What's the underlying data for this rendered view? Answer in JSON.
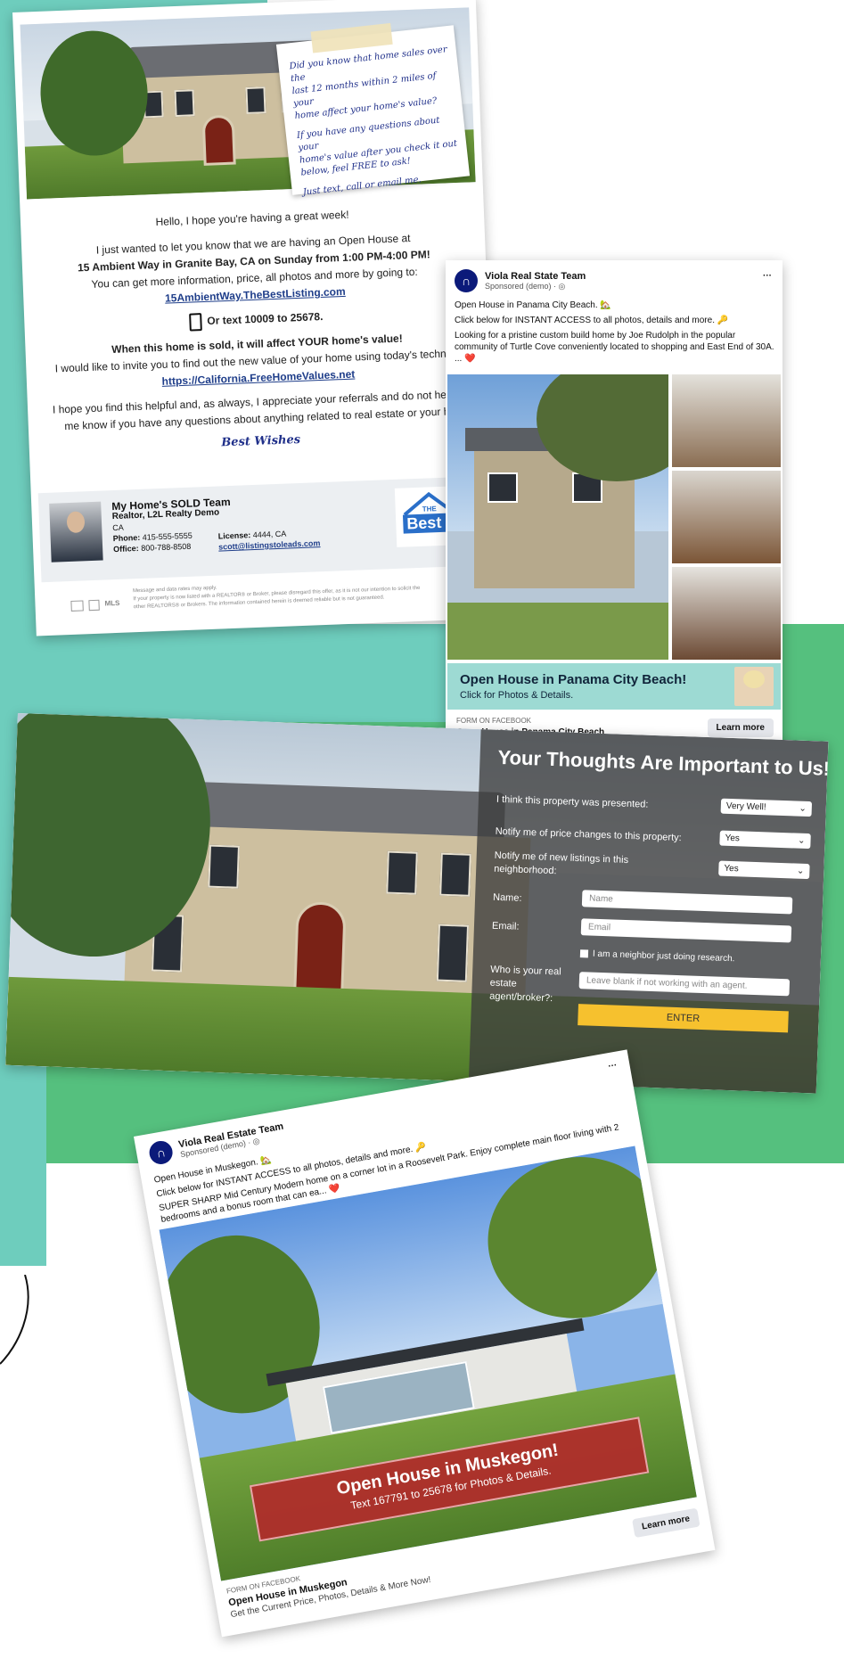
{
  "colors": {
    "teal": "#6ecdbd",
    "green": "#55c07e",
    "fb_blue": "#0b1a7a",
    "enter": "#f6c12e",
    "banner_teal": "#9ddad3",
    "banner_red": "#b5262a",
    "link": "#1f3e8a"
  },
  "letter": {
    "note": {
      "line1": "Did you know that home sales over the",
      "line2": "last 12 months within 2 miles of your",
      "line3": "home affect your home's value?",
      "line4": "If you have any questions about your",
      "line5": "home's value after you check it out",
      "line6": "below, feel FREE to ask!",
      "line7": "Just text, call or email me."
    },
    "greeting": "Hello, I hope you're having a great week!",
    "p1a": "I just wanted to let you know that we are having an Open House at",
    "p1b": "15 Ambient Way in Granite Bay, CA on Sunday from 1:00 PM-4:00 PM!",
    "p1c": "You can get more information, price, all photos and more by going to:",
    "link1": "15AmbientWay.TheBestListing.com",
    "text_line": "Or text 10009 to 25678.",
    "sold_line": "When this home is sold, it will affect YOUR home's value!",
    "invite": "I would like to invite you to find out the new value of your home using today's technolo",
    "link2": "https://California.FreeHomeValues.net",
    "closing1": "I hope you find this helpful and, as always, I appreciate your referrals and do not hesitat",
    "closing2": "me know if you have any questions about anything related to real estate or your ho",
    "best": "Best Wishes",
    "team": {
      "name": "My Home's SOLD Team",
      "company": "Realtor, L2L Realty Demo",
      "state": "CA",
      "phone_label": "Phone:",
      "phone": "415-555-5555",
      "office_label": "Office:",
      "office": "800-788-8508",
      "license_label": "License:",
      "license": "4444, CA",
      "email": "scott@listingstoleads.com"
    },
    "logo_the": "THE",
    "logo_best": "Best List",
    "disclaimer1": "Message and data rates may apply.",
    "disclaimer2": "If your property is now listed with a REALTOR® or Broker, please disregard this offer, as it is not our intention to solicit the",
    "disclaimer3": "other REALTORS® or Brokers. The information contained herein is deemed reliable but is not guaranteed.",
    "mls": "MLS"
  },
  "fb_ad1": {
    "page": "Viola Real State Team",
    "sponsored": "Sponsored (demo) · ",
    "more": "···",
    "line1": "Open House in Panama City Beach. 🏡",
    "line2": "Click below for INSTANT ACCESS to all photos, details and more. 🔑",
    "line3": "Looking for a pristine custom build home by Joe Rudolph in the popular community of Turtle Cove conveniently located to shopping and East End of 30A. ... ❤️",
    "banner_title": "Open House in Panama City Beach!",
    "banner_sub": "Click for Photos & Details.",
    "form_label": "FORM ON FACEBOOK",
    "form_title": "Open House in Panama City Beach",
    "cta": "Learn more"
  },
  "form": {
    "title": "Your Thoughts Are Important to Us!",
    "q1": "I think this property was presented:",
    "a1": "Very Well!",
    "q2": "Notify me of price changes to this property:",
    "a2": "Yes",
    "q3": "Notify me of new listings in this neighborhood:",
    "a3": "Yes",
    "name_label": "Name:",
    "name_ph": "Name",
    "email_label": "Email:",
    "email_ph": "Email",
    "neighbor": "I am a neighbor just doing research.",
    "agent_label": "Who is your real estate agent/broker?:",
    "agent_ph": "Leave blank if not working with an agent.",
    "enter": "ENTER"
  },
  "fb_ad2": {
    "page": "Viola Real Estate Team",
    "sponsored": "Sponsored (demo) · ",
    "more": "···",
    "line1": "Open House in Muskegon. 🏡",
    "line2": "Click below for INSTANT ACCESS to all photos, details and more. 🔑",
    "line3": "SUPER SHARP Mid Century Modern home on a corner lot in a Roosevelt Park. Enjoy complete main floor living with 2 bedrooms and a bonus room that can ea... ❤️",
    "banner_title": "Open House in Muskegon!",
    "banner_sub": "Text 167791 to 25678 for Photos & Details.",
    "form_label": "FORM ON FACEBOOK",
    "form_title": "Open House in Muskegon",
    "form_sub": "Get the Current Price, Photos, Details & More Now!",
    "cta": "Learn more"
  }
}
